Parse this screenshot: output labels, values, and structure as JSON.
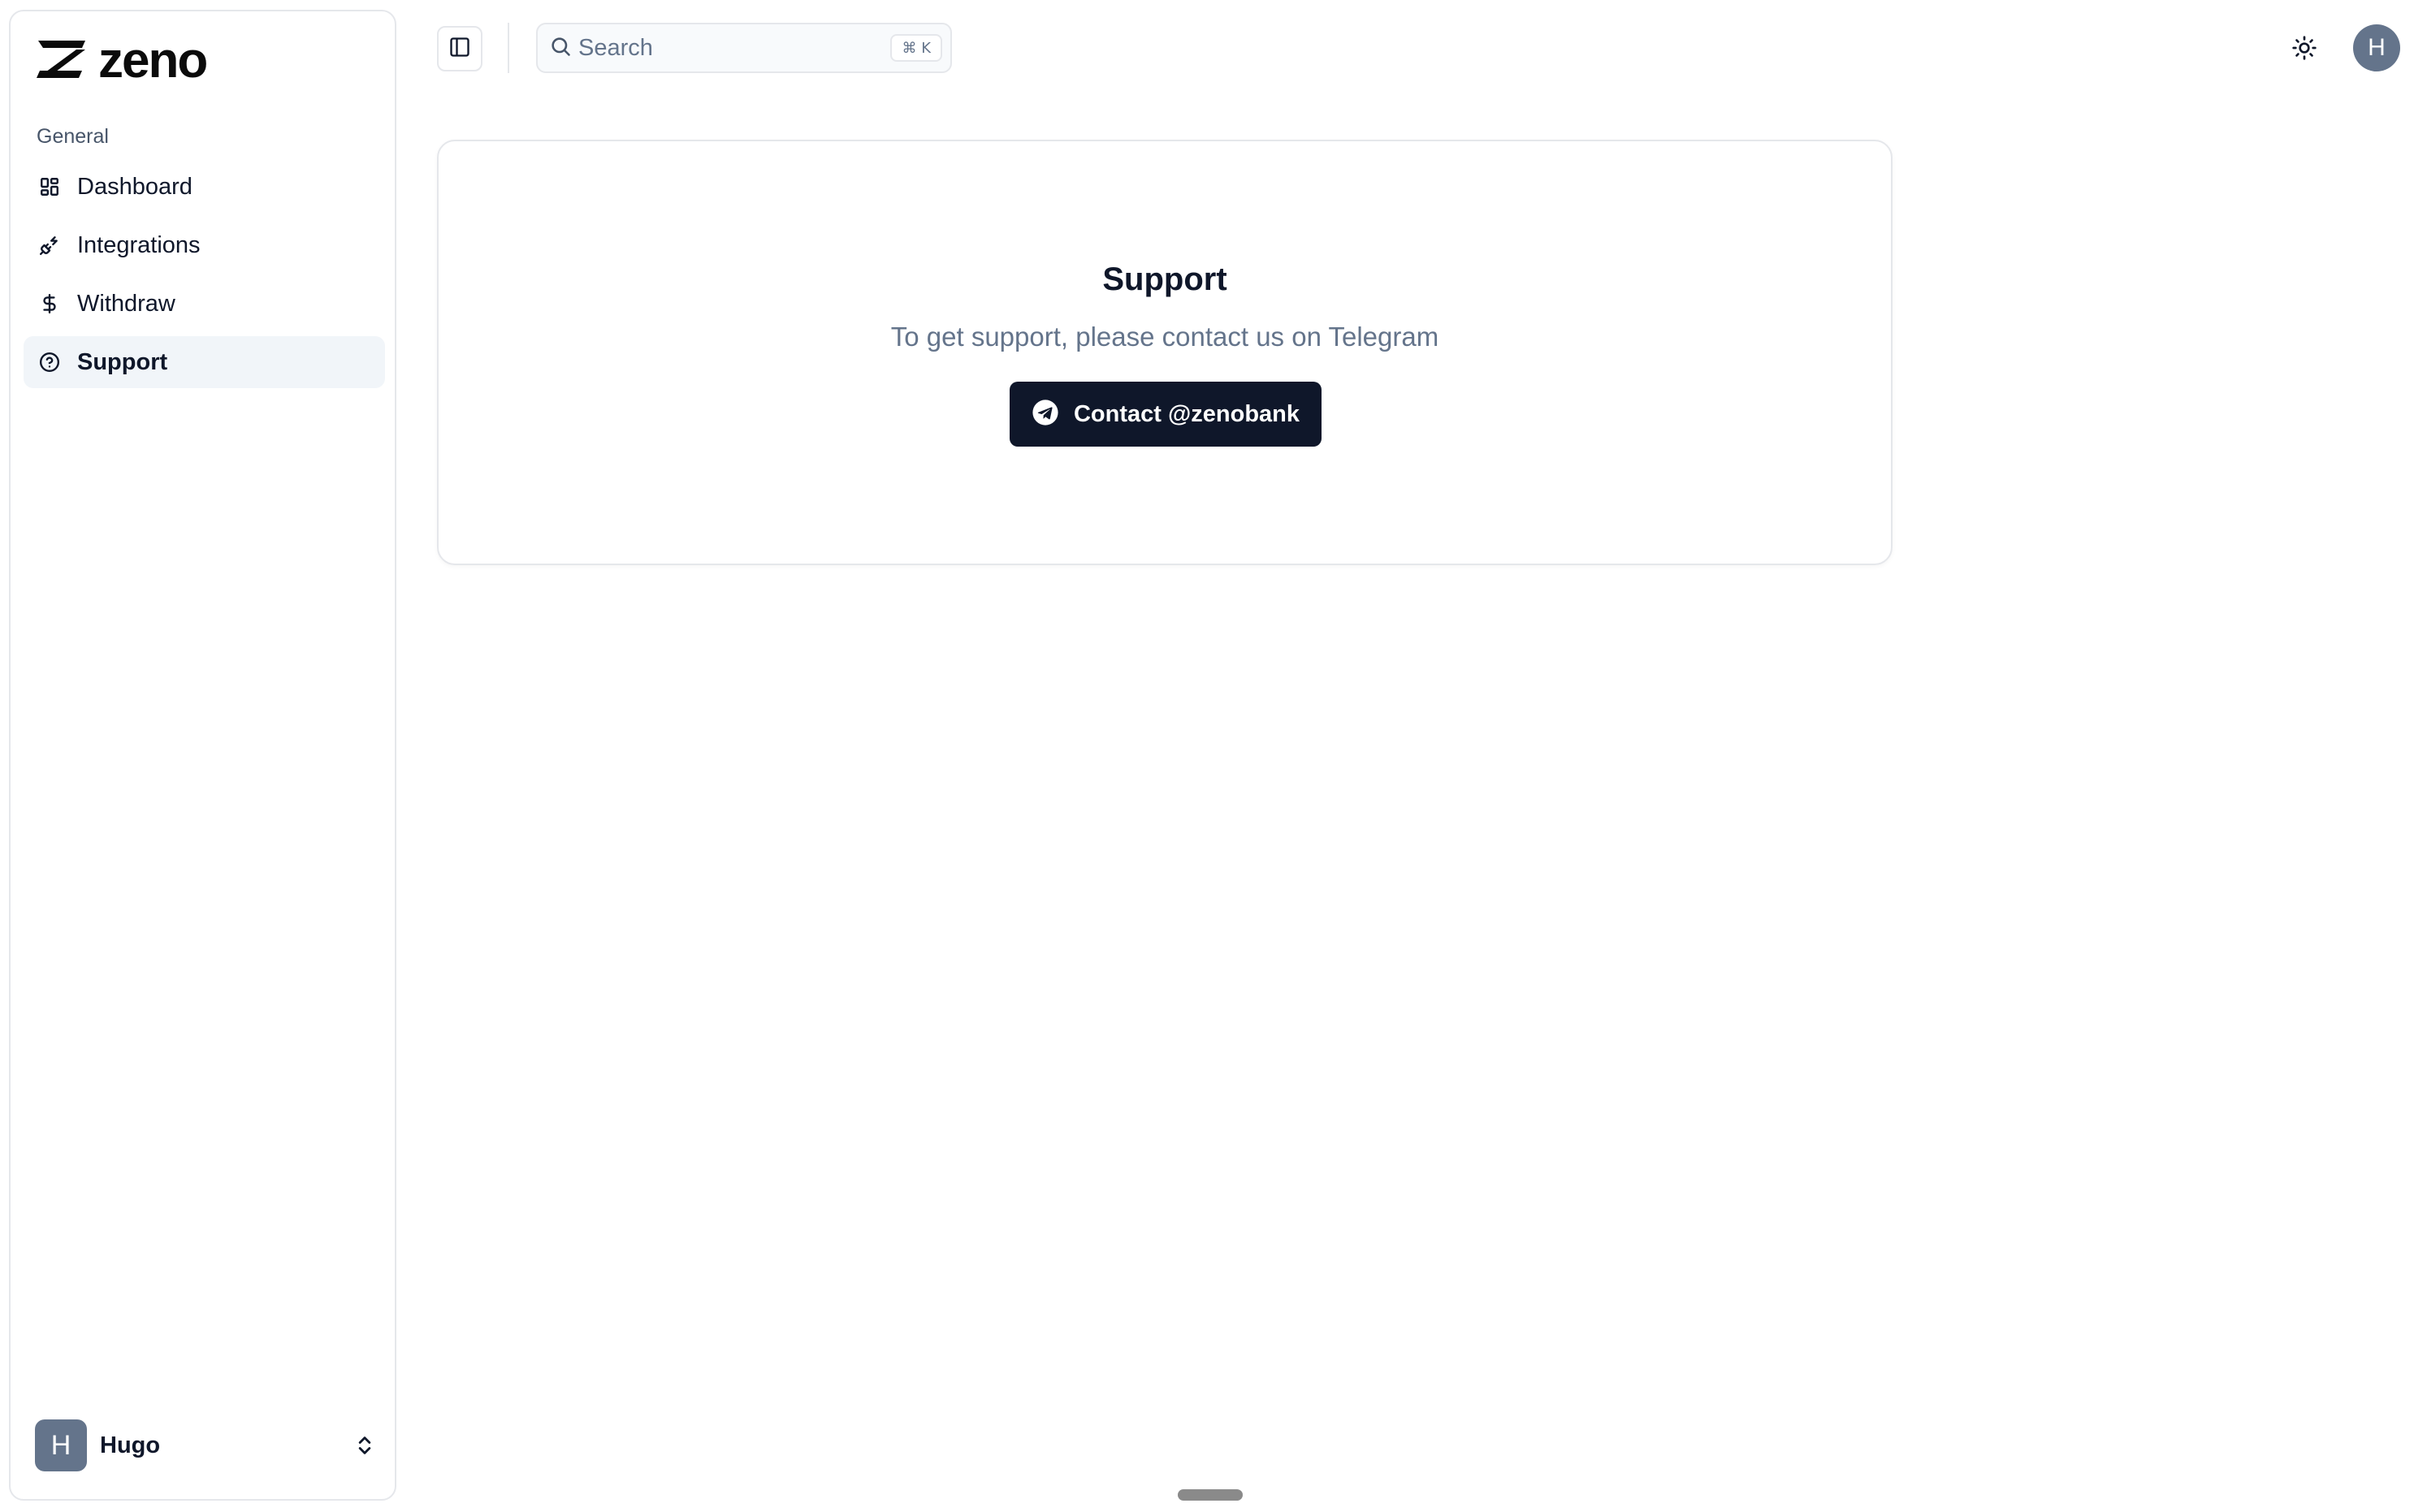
{
  "app": {
    "logo_text": "zeno"
  },
  "sidebar": {
    "group_label": "General",
    "items": [
      {
        "label": "Dashboard",
        "icon": "dashboard-icon",
        "active": false
      },
      {
        "label": "Integrations",
        "icon": "plug-icon",
        "active": false
      },
      {
        "label": "Withdraw",
        "icon": "dollar-icon",
        "active": false
      },
      {
        "label": "Support",
        "icon": "help-circle-icon",
        "active": true
      }
    ],
    "user": {
      "initial": "H",
      "name": "Hugo"
    }
  },
  "topbar": {
    "search_placeholder": "Search",
    "search_shortcut": "⌘ K",
    "avatar_initial": "H"
  },
  "support": {
    "title": "Support",
    "text": "To get support, please contact us on Telegram",
    "button_label": "Contact @zenobank"
  },
  "colors": {
    "primary_button": "#0f172a",
    "active_nav_bg": "#f1f5f9",
    "avatar_bg": "#64748b",
    "muted_text": "#64748b"
  }
}
